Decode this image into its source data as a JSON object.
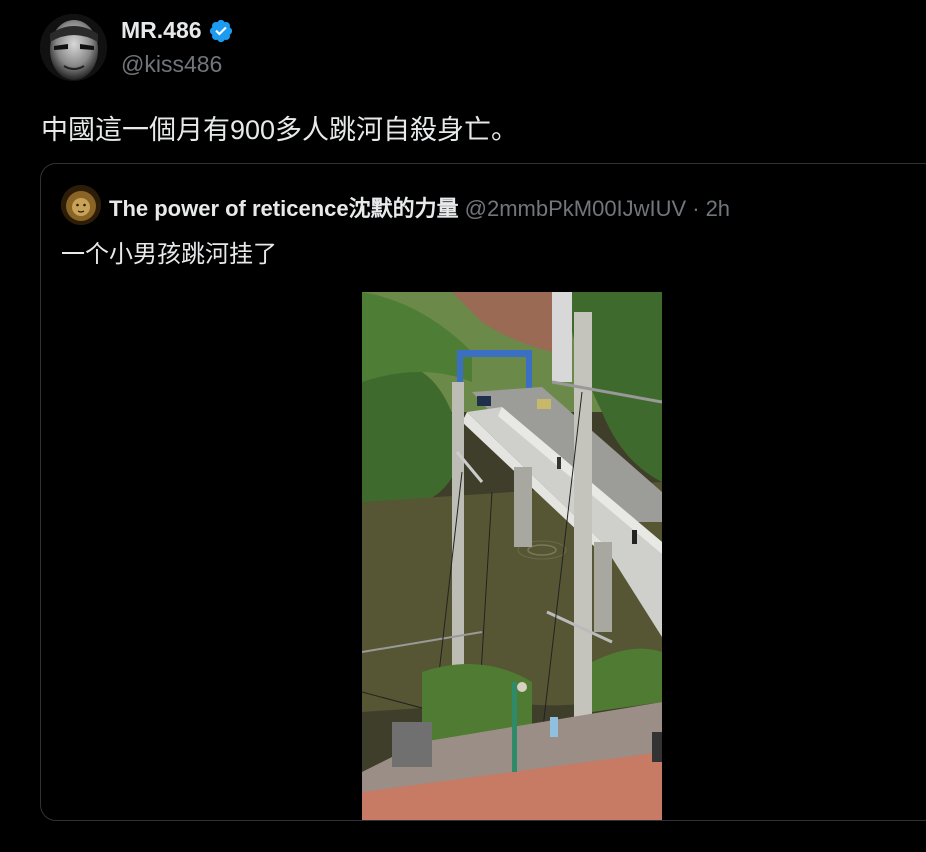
{
  "author": {
    "name": "MR.486",
    "handle": "@kiss486",
    "verified": true,
    "verified_badge_color": "#1d9bf0"
  },
  "tweet": {
    "text": "中國這一個月有900多人跳河自殺身亡。"
  },
  "quote": {
    "author_name": "The power of reticence沈默的力量",
    "author_handle": "@2mmbPkM00IJwIUV",
    "separator": "·",
    "time": "2h",
    "text": "一个小男孩跳河挂了",
    "media_type": "video"
  },
  "colors": {
    "background": "#000000",
    "primary_text": "#e7e9ea",
    "secondary_text": "#71767b",
    "border": "#2f3336"
  }
}
